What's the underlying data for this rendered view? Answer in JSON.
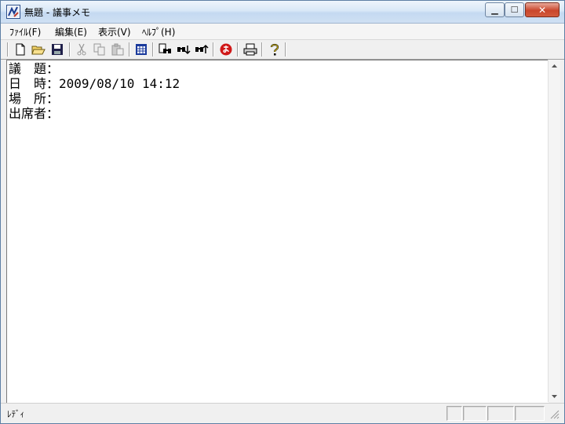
{
  "window": {
    "title": "無題 - 議事メモ",
    "minimize_glyph": "▁",
    "maximize_glyph": "☐",
    "close_glyph": "✕"
  },
  "menu": {
    "items": [
      {
        "label": "ﾌｧｲﾙ(F)"
      },
      {
        "label": "編集(E)"
      },
      {
        "label": "表示(V)"
      },
      {
        "label": "ﾍﾙﾌﾟ(H)"
      }
    ]
  },
  "toolbar": {
    "icons": [
      "new-file-icon",
      "open-folder-icon",
      "save-icon",
      "cut-icon",
      "copy-icon",
      "paste-icon",
      "calendar-icon",
      "find-icon",
      "find-next-icon",
      "find-previous-icon",
      "ime-icon",
      "print-icon",
      "help-icon"
    ]
  },
  "editor": {
    "lines": [
      "議　題：",
      "日　時：2009/08/10 14:12",
      "場　所：",
      "出席者："
    ]
  },
  "status": {
    "text": "ﾚﾃﾞｨ"
  }
}
